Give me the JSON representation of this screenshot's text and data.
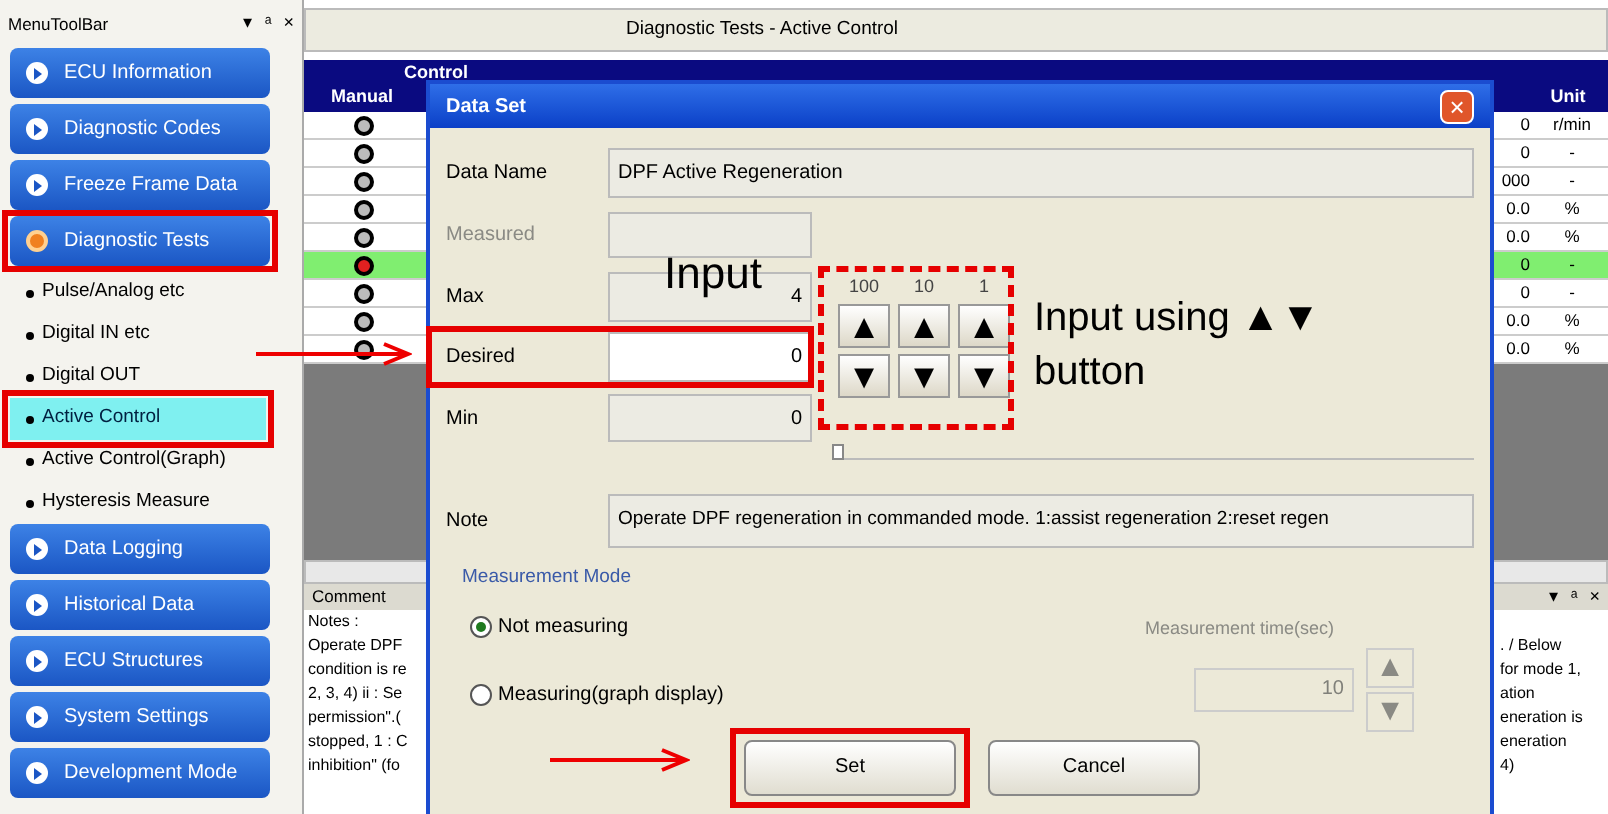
{
  "sidebar": {
    "title": "MenuToolBar",
    "controls": [
      "▾",
      "ᵃ",
      "×"
    ],
    "items": [
      {
        "kind": "group",
        "label": "ECU Information",
        "expanded": false,
        "highlighted": false
      },
      {
        "kind": "group",
        "label": "Diagnostic Codes",
        "expanded": false,
        "highlighted": false
      },
      {
        "kind": "group",
        "label": "Freeze Frame Data",
        "expanded": false,
        "highlighted": false
      },
      {
        "kind": "group",
        "label": "Diagnostic Tests",
        "expanded": true,
        "highlighted": true
      },
      {
        "kind": "sub",
        "label": "Pulse/Analog etc",
        "selected": false,
        "highlighted": false
      },
      {
        "kind": "sub",
        "label": "Digital IN etc",
        "selected": false,
        "highlighted": false
      },
      {
        "kind": "sub",
        "label": "Digital OUT",
        "selected": false,
        "highlighted": false
      },
      {
        "kind": "sub",
        "label": "Active Control",
        "selected": true,
        "highlighted": true
      },
      {
        "kind": "sub",
        "label": "Active Control(Graph)",
        "selected": false,
        "highlighted": false
      },
      {
        "kind": "sub",
        "label": "Hysteresis Measure",
        "selected": false,
        "highlighted": false
      },
      {
        "kind": "group",
        "label": "Data Logging",
        "expanded": false,
        "highlighted": false
      },
      {
        "kind": "group",
        "label": "Historical Data",
        "expanded": false,
        "highlighted": false
      },
      {
        "kind": "group",
        "label": "ECU Structures",
        "expanded": false,
        "highlighted": false
      },
      {
        "kind": "group",
        "label": "System Settings",
        "expanded": false,
        "highlighted": false
      },
      {
        "kind": "group",
        "label": "Development Mode",
        "expanded": false,
        "highlighted": false
      }
    ]
  },
  "main": {
    "title": "Diagnostic Tests - Active Control",
    "table": {
      "columns": {
        "group": "Control",
        "manual": "Manual",
        "unit": "Unit"
      },
      "rows": [
        {
          "selected": false,
          "value": "0",
          "unit": "r/min"
        },
        {
          "selected": false,
          "value": "0",
          "unit": "-"
        },
        {
          "selected": false,
          "value": "000",
          "unit": "-"
        },
        {
          "selected": false,
          "value": "0.0",
          "unit": "%"
        },
        {
          "selected": false,
          "value": "0.0",
          "unit": "%"
        },
        {
          "selected": true,
          "value": "0",
          "unit": "-"
        },
        {
          "selected": false,
          "value": "0",
          "unit": "-"
        },
        {
          "selected": false,
          "value": "0.0",
          "unit": "%"
        },
        {
          "selected": false,
          "value": "0.0",
          "unit": "%"
        }
      ]
    },
    "comment": {
      "title": "Comment",
      "controls": [
        "▾",
        "ᵃ",
        "×"
      ],
      "left_lines": [
        "Notes :",
        "Operate DPF",
        "condition is re",
        "2, 3, 4) ii : Se",
        "permission\".(",
        "stopped, 1 : C",
        "inhibition\" (fo"
      ],
      "right_lines": [
        ". / Below",
        "for mode 1,",
        "ation",
        "eneration is",
        "eneration",
        "4)"
      ]
    }
  },
  "dialog": {
    "title": "Data Set",
    "close": "×",
    "data_name": {
      "label": "Data Name",
      "value": "DPF Active Regeneration"
    },
    "measured": {
      "label": "Measured",
      "disabled": true
    },
    "max": {
      "label": "Max",
      "value": "4"
    },
    "desired": {
      "label": "Desired",
      "value": "0",
      "highlighted": true
    },
    "min": {
      "label": "Min",
      "value": "0"
    },
    "spin": {
      "steps": [
        "100",
        "10",
        "1"
      ],
      "up": "▲",
      "down": "▼",
      "highlighted": true
    },
    "slider": {
      "level": 0.0
    },
    "note": {
      "label": "Note",
      "value": "Operate DPF regeneration in commanded mode. 1:assist regeneration 2:reset regen"
    },
    "measurement_mode": {
      "title": "Measurement Mode",
      "options": [
        {
          "label": "Not measuring",
          "selected": true
        },
        {
          "label": "Measuring(graph display)",
          "selected": false
        }
      ],
      "time": {
        "label": "Measurement time(sec)",
        "value": "10",
        "disabled": true,
        "up": "▲",
        "down": "▼"
      }
    },
    "buttons": [
      {
        "label": "Set",
        "highlighted": true
      },
      {
        "label": "Cancel",
        "highlighted": false
      }
    ]
  },
  "annotations": [
    {
      "text": "Input"
    },
    {
      "text": "Input using ▲▼ button"
    }
  ]
}
